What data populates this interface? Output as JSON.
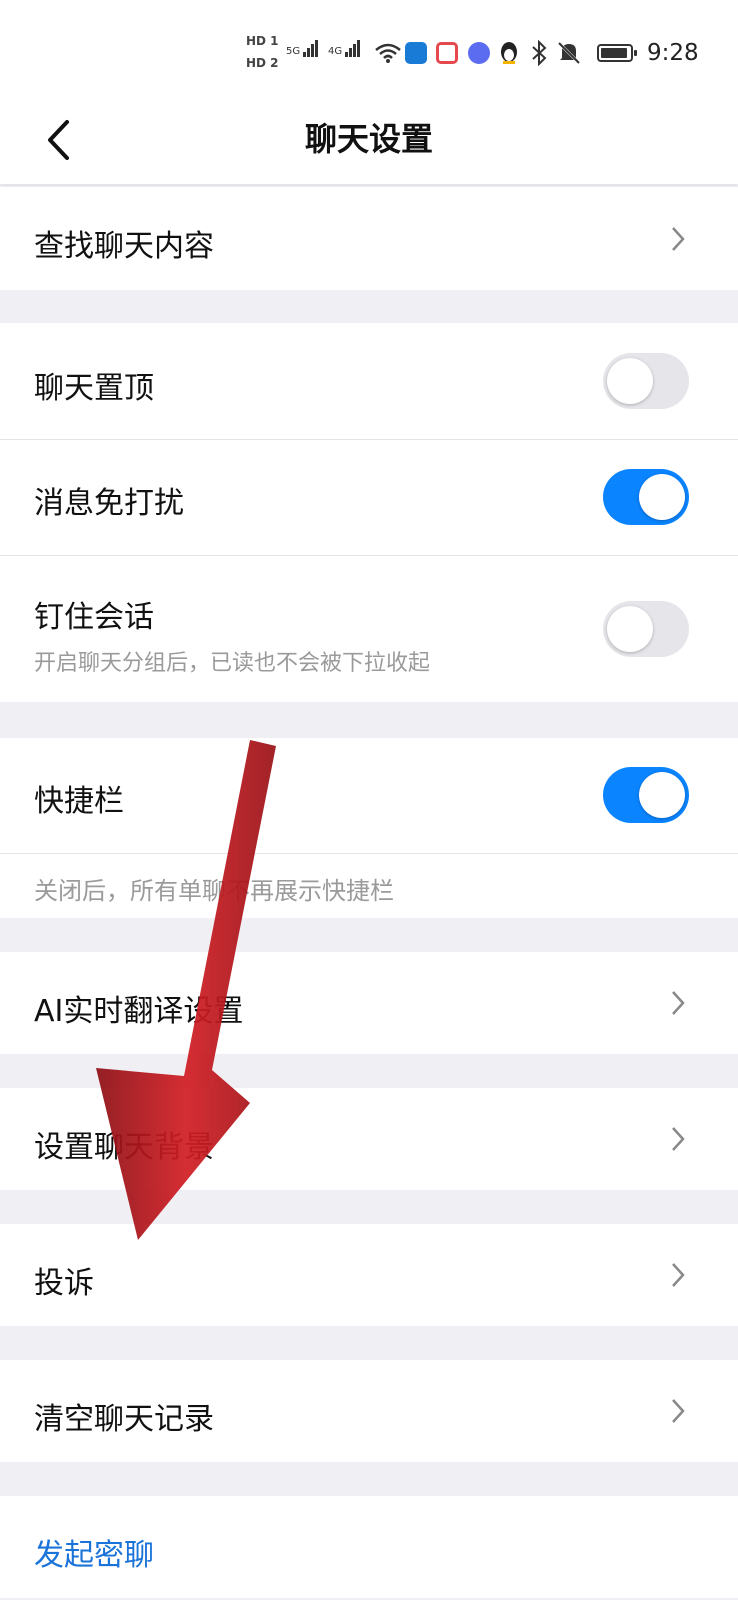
{
  "status_bar": {
    "hd1": "HD 1",
    "hd2": "HD 2",
    "net1": "5G",
    "net2": "4G",
    "time": "9:28"
  },
  "header": {
    "title": "聊天设置"
  },
  "rows": {
    "search": "查找聊天内容",
    "pin_top": "聊天置顶",
    "mute": "消息免打扰",
    "pin_chat": "钉住会话",
    "pin_chat_sub": "开启聊天分组后，已读也不会被下拉收起",
    "quickbar": "快捷栏",
    "quickbar_note": "关闭后，所有单聊不再展示快捷栏",
    "ai_translate": "AI实时翻译设置",
    "set_bg": "设置聊天背景",
    "complain": "投诉",
    "clear": "清空聊天记录",
    "secret_chat": "发起密聊"
  },
  "toggles": {
    "pin_top": false,
    "mute": true,
    "pin_chat": false,
    "quickbar": true
  },
  "colors": {
    "toggle_on": "#0a84ff",
    "toggle_off": "#e5e5ea",
    "link": "#1a73d9",
    "arrow": "#c4161c"
  },
  "icons": [
    "back-arrow-icon",
    "chevron-right-icon",
    "bluetooth-icon",
    "bell-off-icon",
    "battery-icon",
    "wifi-icon",
    "signal-icon"
  ]
}
